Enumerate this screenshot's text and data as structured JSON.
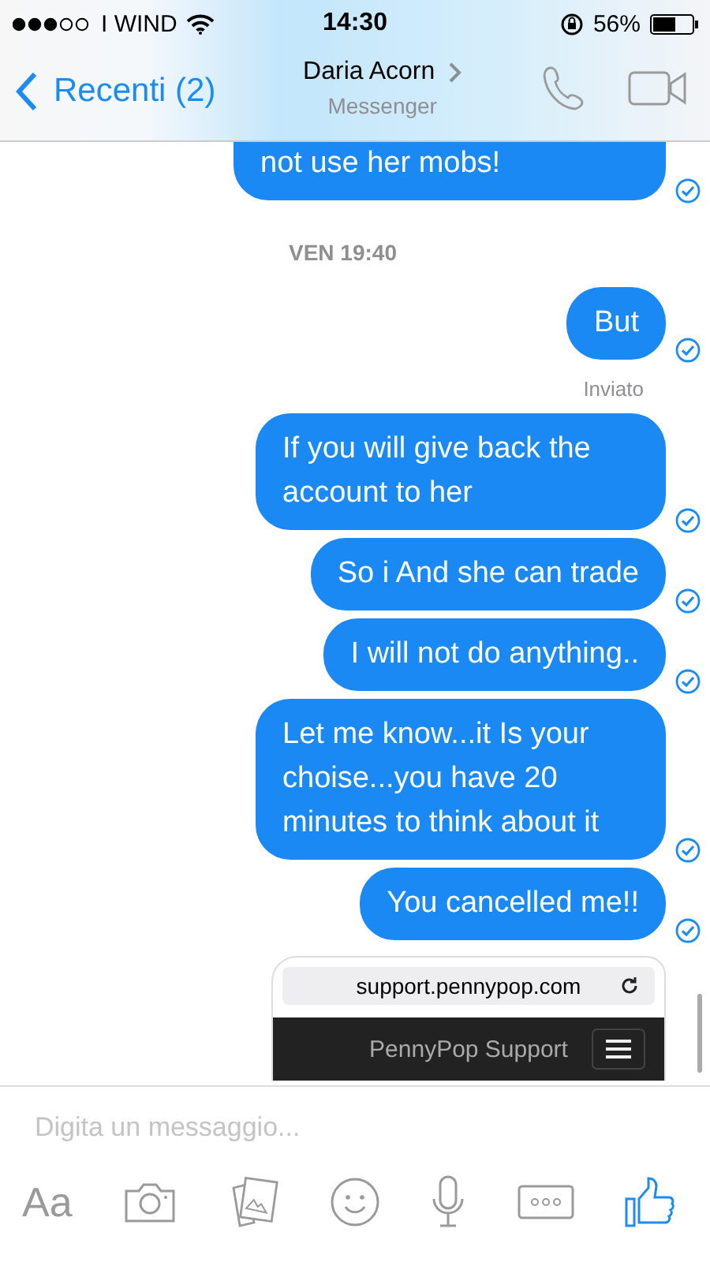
{
  "status_bar": {
    "carrier": "I WIND",
    "time": "14:30",
    "battery": "56%"
  },
  "header": {
    "back": "Recenti (2)",
    "name": "Daria Acorn",
    "subtitle": "Messenger"
  },
  "messages": [
    {
      "kind": "message",
      "text": "not use her mobs!",
      "cut_top": true,
      "delivered": true
    },
    {
      "kind": "timestamp",
      "text": "VEN 19:40"
    },
    {
      "kind": "message",
      "text": "But",
      "cut_top": false,
      "delivered": true
    },
    {
      "kind": "status",
      "text": "Inviato"
    },
    {
      "kind": "message",
      "text": "If you will give back the account to her",
      "cut_top": false,
      "delivered": true
    },
    {
      "kind": "message",
      "text": "So i And she can trade",
      "cut_top": false,
      "delivered": true
    },
    {
      "kind": "message",
      "text": "I will not do anything..",
      "cut_top": false,
      "delivered": true
    },
    {
      "kind": "message",
      "text": "Let me know...it Is your choise...you have 20 minutes to think about it",
      "cut_top": false,
      "delivered": true
    },
    {
      "kind": "message",
      "text": "You cancelled me!!",
      "cut_top": false,
      "delivered": true
    },
    {
      "kind": "link_preview",
      "url": "support.pennypop.com",
      "site": "PennyPop Support"
    }
  ],
  "composer": {
    "placeholder": "Digita un messaggio...",
    "text_button": "Aa"
  }
}
